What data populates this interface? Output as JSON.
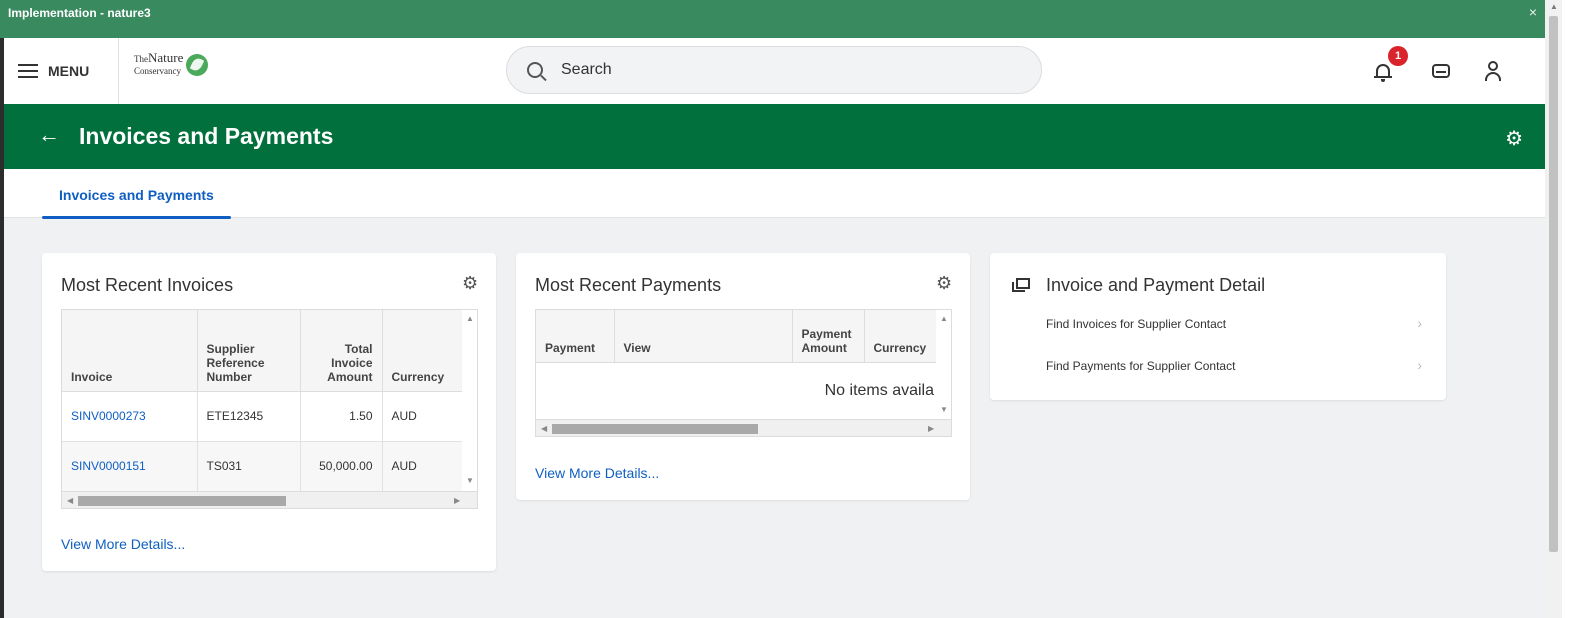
{
  "window": {
    "title": "Implementation - nature3",
    "close_glyph": "×"
  },
  "header": {
    "menu_label": "MENU",
    "logo": {
      "line1_small": "The",
      "line1": "Nature",
      "line2": "Conservancy"
    },
    "search_placeholder": "Search",
    "notification_count": "1"
  },
  "page": {
    "back_glyph": "←",
    "title": "Invoices and Payments",
    "gear_glyph": "⚙"
  },
  "tabs": [
    {
      "label": "Invoices and Payments",
      "active": true
    }
  ],
  "invoices_card": {
    "title": "Most Recent Invoices",
    "columns": [
      "Invoice",
      "Supplier Reference Number",
      "Total Invoice Amount",
      "Currency"
    ],
    "rows": [
      {
        "invoice": "SINV0000273",
        "supplier_ref": "ETE12345",
        "amount": "1.50",
        "currency": "AUD"
      },
      {
        "invoice": "SINV0000151",
        "supplier_ref": "TS031",
        "amount": "50,000.00",
        "currency": "AUD"
      }
    ],
    "view_more": "View More Details..."
  },
  "payments_card": {
    "title": "Most Recent Payments",
    "columns": [
      "Payment",
      "View",
      "Payment Amount",
      "Currency"
    ],
    "empty_message": "No items availa",
    "view_more": "View More Details..."
  },
  "detail_card": {
    "title": "Invoice and Payment Detail",
    "items": [
      {
        "label": "Find Invoices for Supplier Contact"
      },
      {
        "label": "Find Payments for Supplier Contact"
      }
    ]
  }
}
